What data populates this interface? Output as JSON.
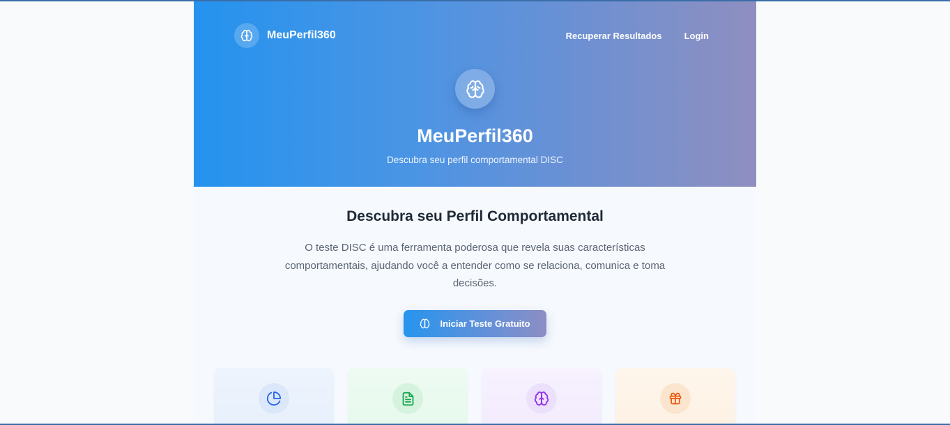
{
  "header": {
    "brand_name": "MeuPerfil360",
    "nav": [
      {
        "label": "Recuperar Resultados"
      },
      {
        "label": "Login"
      }
    ]
  },
  "hero": {
    "title": "MeuPerfil360",
    "subtitle": "Descubra seu perfil comportamental DISC"
  },
  "intro": {
    "title": "Descubra seu Perfil Comportamental",
    "description": "O teste DISC é uma ferramenta poderosa que revela suas características comportamentais, ajudando você a entender como se relaciona, comunica e toma decisões.",
    "cta_label": "Iniciar Teste Gratuito"
  },
  "feature_cards": [
    {
      "icon": "pie-chart-icon",
      "accent": "#2563eb",
      "background": "#eaf1fd"
    },
    {
      "icon": "document-icon",
      "accent": "#16a34a",
      "background": "#e9f9ee"
    },
    {
      "icon": "brain-icon",
      "accent": "#9333ea",
      "background": "#f4eefd"
    },
    {
      "icon": "gift-icon",
      "accent": "#ea580c",
      "background": "#fdf2e6"
    }
  ],
  "colors": {
    "gradient_start": "#2493ee",
    "gradient_end": "#8f8fc0",
    "title_text": "#1f2937",
    "body_text": "#5b6474"
  }
}
